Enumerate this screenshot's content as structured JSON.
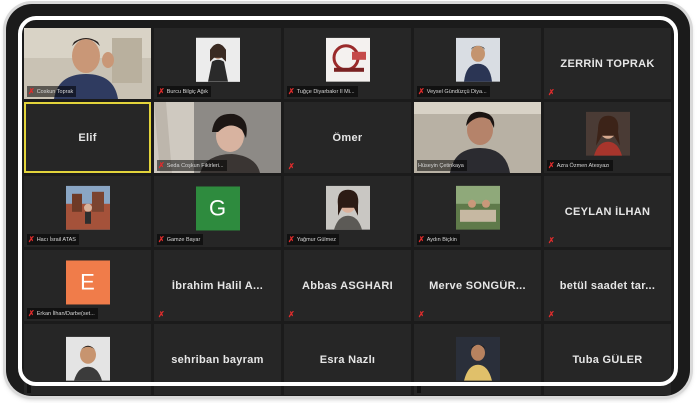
{
  "window": {
    "title": ""
  },
  "participants": [
    {
      "id": "p1",
      "display": "video",
      "label": "Coskun Toprak",
      "muted": true
    },
    {
      "id": "p2",
      "display": "photo",
      "label": "Burcu Bilgiç Ağık",
      "muted": true
    },
    {
      "id": "p3",
      "display": "photo",
      "label": "Tuğçe Diyarbakır Il Mi...",
      "muted": true
    },
    {
      "id": "p4",
      "display": "photo",
      "label": "Veysel Gündüzçü Diya...",
      "muted": true
    },
    {
      "id": "p5",
      "display": "name",
      "name": "ZERRİN TOPRAK",
      "muted": true
    },
    {
      "id": "p6",
      "display": "name",
      "name": "Elif",
      "muted": false,
      "active": true
    },
    {
      "id": "p7",
      "display": "video",
      "label": "Seda Coşkun Fikirleri...",
      "muted": true
    },
    {
      "id": "p8",
      "display": "name",
      "name": "Ömer",
      "muted": true
    },
    {
      "id": "p9",
      "display": "video",
      "label": "Hüseyin Çetinkaya",
      "muted": false
    },
    {
      "id": "p10",
      "display": "photo",
      "label": "Azra Özmen Atesyazı",
      "muted": true
    },
    {
      "id": "p11",
      "display": "photo",
      "label": "Hacı İsrail ATAS",
      "muted": true
    },
    {
      "id": "p12",
      "display": "letter",
      "letter": "G",
      "letter_color": "#2e8b3e",
      "label": "Gamze Bayar",
      "muted": true
    },
    {
      "id": "p13",
      "display": "photo",
      "label": "Yağmur Gülmez",
      "muted": true
    },
    {
      "id": "p14",
      "display": "photo",
      "label": "Aydın Biçkin",
      "muted": true
    },
    {
      "id": "p15",
      "display": "name",
      "name": "CEYLAN İLHAN",
      "muted": true
    },
    {
      "id": "p16",
      "display": "letter",
      "letter": "E",
      "letter_color": "#f07c4a",
      "label": "Erkan İlhan/Darbe(set...",
      "muted": true
    },
    {
      "id": "p17",
      "display": "name",
      "name": "İbrahim Halil A...",
      "muted": true
    },
    {
      "id": "p18",
      "display": "name",
      "name": "Abbas ASGHARI",
      "muted": true
    },
    {
      "id": "p19",
      "display": "name",
      "name": "Merve SONGÜR...",
      "muted": true
    },
    {
      "id": "p20",
      "display": "name",
      "name": "betül saadet tar...",
      "muted": true
    },
    {
      "id": "p21",
      "display": "photo",
      "label": "",
      "muted": false
    },
    {
      "id": "p22",
      "display": "name",
      "name": "sehriban bayram",
      "muted": false
    },
    {
      "id": "p23",
      "display": "name",
      "name": "Esra Nazlı",
      "muted": false
    },
    {
      "id": "p24",
      "display": "photo",
      "label": "",
      "muted": false
    },
    {
      "id": "p25",
      "display": "name",
      "name": "Tuba GÜLER",
      "muted": false
    }
  ],
  "colors": {
    "tile_bg": "#262626",
    "active_border": "#e3d43b",
    "muted_mic": "#e02c2c",
    "name_text": "#e6e6e6"
  },
  "icons": {
    "muted": "mic-muted-icon"
  }
}
